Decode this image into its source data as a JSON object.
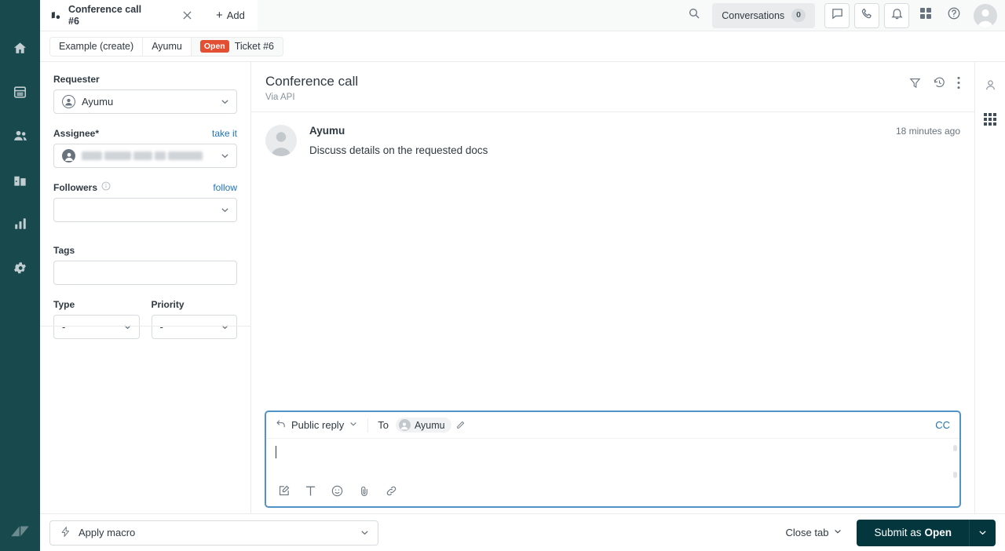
{
  "topbar": {
    "tab": {
      "icon": "ticket-icon",
      "title": "Conference call",
      "number": "#6",
      "close_icon": "close-icon"
    },
    "add_tab_label": "Add",
    "search_icon": "search-icon",
    "conversations_label": "Conversations",
    "conversations_count": "0",
    "icons": [
      "chat-icon",
      "phone-icon",
      "bell-icon",
      "apps-grid-icon",
      "help-icon"
    ],
    "avatar": "user-avatar"
  },
  "breadcrumb": {
    "items": [
      {
        "label": "Example (create)",
        "badge": ""
      },
      {
        "label": "Ayumu",
        "badge": ""
      },
      {
        "label": "Ticket #6",
        "badge": "Open"
      }
    ]
  },
  "properties": {
    "requester": {
      "label": "Requester",
      "value": "Ayumu"
    },
    "assignee": {
      "label": "Assignee*",
      "action": "take it",
      "value": ""
    },
    "followers": {
      "label": "Followers",
      "action": "follow",
      "value": ""
    },
    "tags": {
      "label": "Tags",
      "value": ""
    },
    "type": {
      "label": "Type",
      "value": "-"
    },
    "priority": {
      "label": "Priority",
      "value": "-"
    }
  },
  "ticket": {
    "subject": "Conference call",
    "via": "Via API",
    "header_icons": [
      "filter-icon",
      "history-icon",
      "more-options-icon"
    ],
    "comments": [
      {
        "author": "Ayumu",
        "time": "18 minutes ago",
        "text": "Discuss details on the requested docs"
      }
    ]
  },
  "composer": {
    "reply_type": "Public reply",
    "to_label": "To",
    "recipient": "Ayumu",
    "cc_label": "CC",
    "body": "",
    "tools": [
      "insert-template-icon",
      "text-format-icon",
      "emoji-icon",
      "attachment-icon",
      "link-icon"
    ]
  },
  "context_rail": {
    "icons": [
      "customer-context-icon",
      "apps-panel-icon"
    ]
  },
  "footer": {
    "macro_placeholder": "Apply macro",
    "close_tab_label": "Close tab",
    "submit_prefix": "Submit as",
    "submit_status": "Open"
  },
  "nav": {
    "items": [
      {
        "name": "home",
        "label": "Home"
      },
      {
        "name": "views",
        "label": "Views"
      },
      {
        "name": "customers",
        "label": "Customers"
      },
      {
        "name": "organizations",
        "label": "Organizations"
      },
      {
        "name": "reporting",
        "label": "Reporting"
      },
      {
        "name": "admin",
        "label": "Admin"
      }
    ],
    "logo": "zendesk-logo"
  },
  "colors": {
    "brand_dark": "#17494d",
    "status_open": "#e34f32",
    "link_blue": "#1f73b7",
    "submit_dark": "#03363d"
  }
}
